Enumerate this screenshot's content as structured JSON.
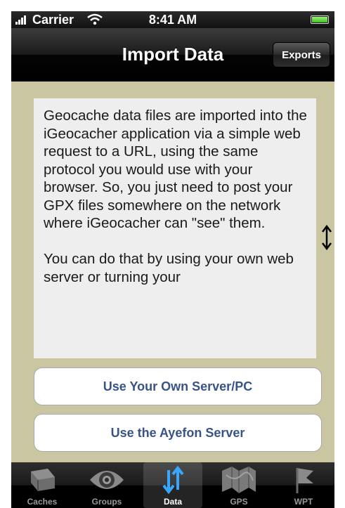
{
  "status_bar": {
    "carrier": "Carrier",
    "time": "8:41 AM"
  },
  "nav": {
    "title": "Import Data",
    "exports_label": "Exports"
  },
  "info": {
    "paragraphs": [
      "Geocache data files are imported into the iGeocacher application via a simple web request to a URL, using the same protocol you would use with your browser. So, you just need to post your GPX files somewhere on the network where iGeocacher can \"see\" them.",
      "You can do that by using your own web server or turning your"
    ]
  },
  "buttons": {
    "own_server": "Use Your Own Server/PC",
    "ayefon_server": "Use the Ayefon Server"
  },
  "tabs": [
    {
      "label": "Caches",
      "icon": "cache-box-icon",
      "selected": false
    },
    {
      "label": "Groups",
      "icon": "eye-icon",
      "selected": false
    },
    {
      "label": "Data",
      "icon": "up-down-arrows-icon",
      "selected": true
    },
    {
      "label": "GPS",
      "icon": "map-icon",
      "selected": false
    },
    {
      "label": "WPT",
      "icon": "flag-icon",
      "selected": false
    }
  ],
  "colors": {
    "background": "#c9c6a1",
    "button_text": "#385487",
    "battery": "#3fbf1e"
  }
}
